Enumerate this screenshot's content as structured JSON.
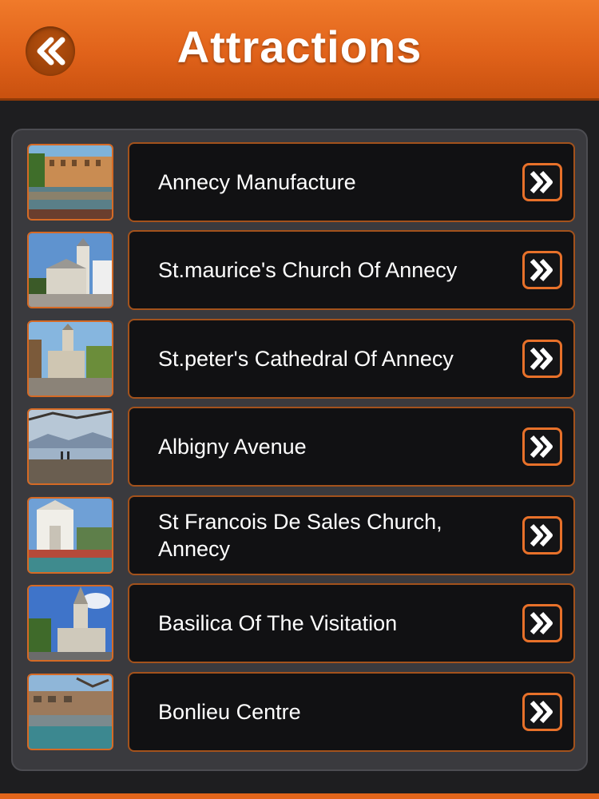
{
  "header": {
    "title": "Attractions",
    "back_icon": "double-chevron-left-icon"
  },
  "colors": {
    "header_orange": "#e8711f",
    "accent_border": "#e8712a",
    "card_background": "#111113",
    "panel_background": "#3a3a3e"
  },
  "attractions": {
    "items": [
      {
        "label": "Annecy Manufacture",
        "thumbnail": "canal-buildings-photo"
      },
      {
        "label": "St.maurice's Church Of Annecy",
        "thumbnail": "church-tower-photo"
      },
      {
        "label": "St.peter's Cathedral Of Annecy",
        "thumbnail": "cathedral-photo"
      },
      {
        "label": "Albigny Avenue",
        "thumbnail": "lakeside-avenue-photo"
      },
      {
        "label": "St Francois De Sales Church, Annecy",
        "thumbnail": "church-facade-photo"
      },
      {
        "label": "Basilica Of The Visitation",
        "thumbnail": "basilica-spire-photo"
      },
      {
        "label": "Bonlieu Centre",
        "thumbnail": "canal-centre-photo"
      }
    ],
    "item_action_icon": "double-chevron-right-icon"
  }
}
